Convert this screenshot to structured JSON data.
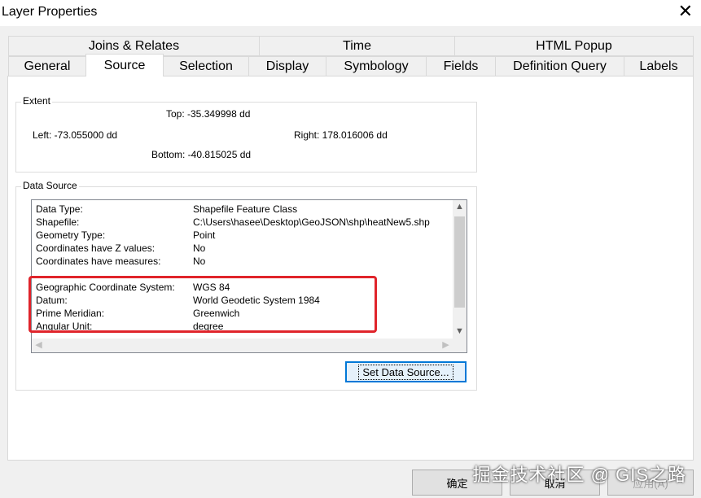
{
  "window": {
    "title": "Layer Properties",
    "close_glyph": "✕"
  },
  "tabs_row1": [
    {
      "label": "Joins & Relates"
    },
    {
      "label": "Time"
    },
    {
      "label": "HTML Popup"
    }
  ],
  "tabs_row2": [
    {
      "label": "General"
    },
    {
      "label": "Source",
      "active": true
    },
    {
      "label": "Selection"
    },
    {
      "label": "Display"
    },
    {
      "label": "Symbology"
    },
    {
      "label": "Fields"
    },
    {
      "label": "Definition Query"
    },
    {
      "label": "Labels"
    }
  ],
  "extent": {
    "label": "Extent",
    "top": "Top:  -35.349998 dd",
    "left": "Left: -73.055000 dd",
    "right": "Right:  178.016006 dd",
    "bottom": "Bottom:  -40.815025 dd"
  },
  "data_source": {
    "label": "Data Source",
    "rows": [
      {
        "key": "Data Type:",
        "value": "Shapefile Feature Class"
      },
      {
        "key": "Shapefile:",
        "value": "C:\\Users\\hasee\\Desktop\\GeoJSON\\shp\\heatNew5.shp"
      },
      {
        "key": "Geometry Type:",
        "value": "Point"
      },
      {
        "key": "Coordinates have Z values:",
        "value": "No"
      },
      {
        "key": "Coordinates have measures:",
        "value": "No"
      },
      {
        "key": "",
        "value": ""
      },
      {
        "key": "Geographic Coordinate System:",
        "value": "WGS 84"
      },
      {
        "key": "Datum:",
        "value": "World Geodetic System 1984"
      },
      {
        "key": "Prime Meridian:",
        "value": "Greenwich"
      },
      {
        "key": "Angular Unit:",
        "value": "degree"
      }
    ],
    "set_button": "Set Data Source..."
  },
  "footer": {
    "ok": "确定",
    "cancel": "取消",
    "apply": "应用(A)"
  },
  "watermark": "掘金技术社区 @ GIS之路",
  "colors": {
    "highlight_box": "#e0242b",
    "focus_border": "#0078d7"
  }
}
